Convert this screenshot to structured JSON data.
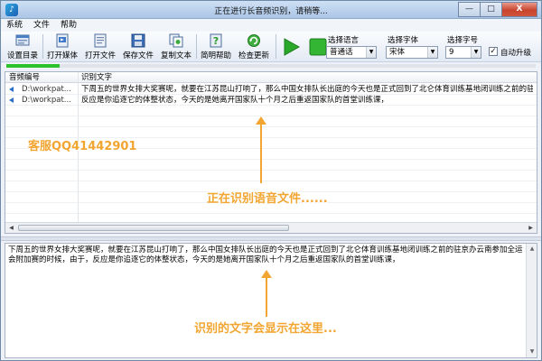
{
  "window": {
    "title": "正在进行长音频识别，请稍等...",
    "controls": {
      "minimize": "—",
      "maximize": "□",
      "close": "X"
    }
  },
  "menu": [
    "系统",
    "文件",
    "帮助"
  ],
  "toolbar": {
    "buttons": [
      {
        "label": "设置目录",
        "icon": "settings-dir-icon"
      },
      {
        "label": "打开媒体",
        "icon": "open-media-icon"
      },
      {
        "label": "打开文件",
        "icon": "open-file-icon"
      },
      {
        "label": "保存文件",
        "icon": "save-icon"
      },
      {
        "label": "复制文本",
        "icon": "copy-icon"
      },
      {
        "label": "简明帮助",
        "icon": "help-icon"
      },
      {
        "label": "检查更新",
        "icon": "update-icon"
      }
    ],
    "play_icon": "play-icon",
    "stop_icon": "stop-icon",
    "language": {
      "label": "选择语言",
      "value": "普通话"
    },
    "font": {
      "label": "选择字体",
      "value": "宋体"
    },
    "font_size": {
      "label": "选择字号",
      "value": "9"
    },
    "auto_upgrade": {
      "label": "自动升级",
      "checked": true
    }
  },
  "progress": {
    "fraction": 0.1
  },
  "table": {
    "columns": [
      "音频编号",
      "识别文字"
    ],
    "rows": [
      {
        "file": "D:\\workpat...",
        "text": "下周五的世界女排大奖赛呢，就要在江苏昆山打响了，那么中国女排队长出庭的今天也是正式回到了北仑体育训练基地闭训练之前的驻京办云南"
      },
      {
        "file": "D:\\workpat...",
        "text": "反应是你追逐它的体整状态，今天的是她离开国家队十个月之后重返国家队的首堂训练课，"
      }
    ]
  },
  "result_text": "下周五的世界女排大奖赛呢，就要在江苏昆山打响了，那么中国女排队长出庭的今天也是正式回到了北仑体育训练基地闭训练之前的驻京办云南参加全运会附加赛的时候，由于，反应是你追逐它的体整状态，今天的是她离开国家队十个月之后重返国家队的首堂训练课，",
  "overlays": {
    "contact": "客服QQ41442901",
    "recognizing": "正在识别语音文件......",
    "result_hint": "识别的文字会显示在这里..."
  },
  "colors": {
    "accent_overlay": "#f2a530",
    "progress_fill": "#2cc22c",
    "play": "#2aa82a"
  }
}
